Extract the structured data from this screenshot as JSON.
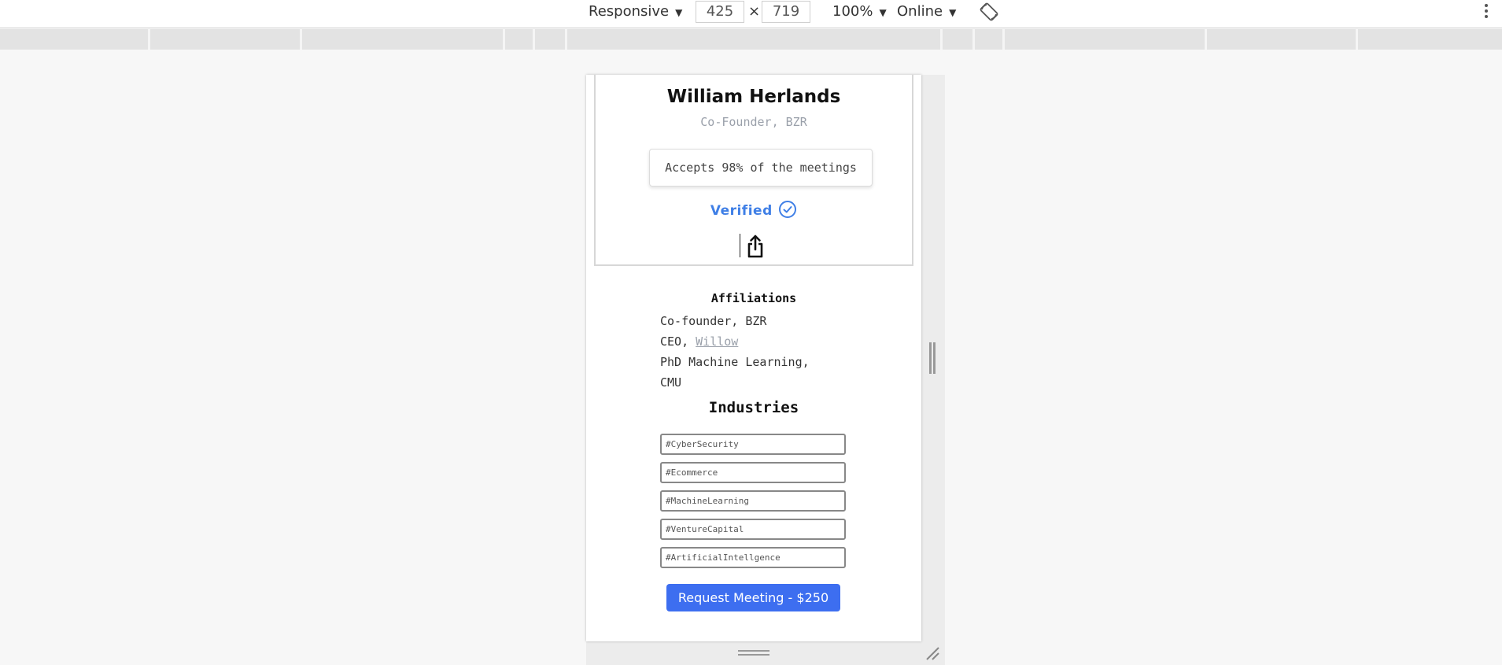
{
  "devtools": {
    "device_label": "Responsive",
    "width_value": "425",
    "height_value": "719",
    "times_sign": "×",
    "zoom_label": "100%",
    "network_label": "Online",
    "dropdown_arrow": "▼",
    "rotate_icon": "rotate-icon",
    "more_icon": "more-vert-icon"
  },
  "profile": {
    "name": "William Herlands",
    "title": "Co-Founder, BZR",
    "acceptance": "Accepts 98% of the meetings",
    "verified_label": "Verified",
    "share_icon": "share-icon"
  },
  "affiliations": {
    "heading": "Affiliations",
    "line1": "Co-founder, BZR",
    "line2_prefix": "CEO, ",
    "line2_link": "Willow",
    "line3": "PhD Machine Learning,",
    "line4": "CMU"
  },
  "industries": {
    "heading": "Industries",
    "tags": [
      "#CyberSecurity",
      "#Ecommerce",
      "#MachineLearning",
      "#VentureCapital",
      "#ArtificialIntellgence"
    ]
  },
  "cta": {
    "label": "Request Meeting - $250"
  },
  "colors": {
    "accent": "#3d6ef0",
    "verified": "#3f7fe6",
    "muted": "#9aa0aa"
  }
}
